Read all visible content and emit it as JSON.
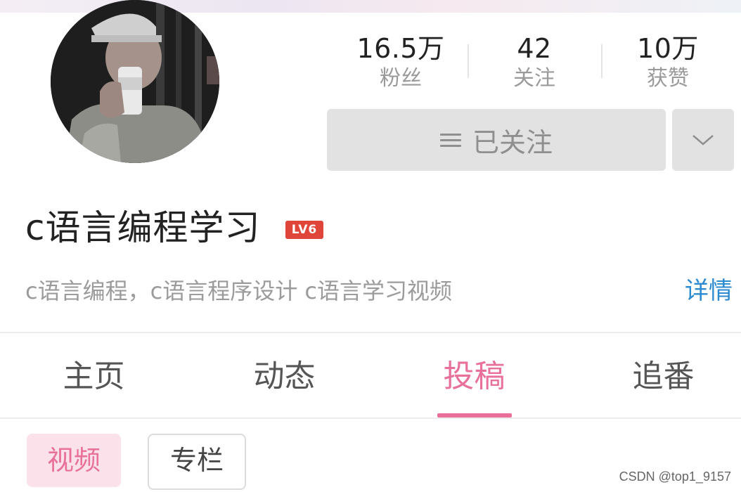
{
  "profile": {
    "name": "c语言编程学习",
    "level": "LV6",
    "description": "c语言编程，c语言程序设计 c语言学习视频",
    "detail_link": "详情"
  },
  "stats": [
    {
      "value": "16.5万",
      "label": "粉丝"
    },
    {
      "value": "42",
      "label": "关注"
    },
    {
      "value": "10万",
      "label": "获赞"
    }
  ],
  "follow_button": {
    "label": "已关注",
    "icon": "menu-icon"
  },
  "dropdown_button": {
    "icon": "chevron-down-icon"
  },
  "tabs": [
    {
      "label": "主页",
      "active": false
    },
    {
      "label": "动态",
      "active": false
    },
    {
      "label": "投稿",
      "active": true
    },
    {
      "label": "追番",
      "active": false
    }
  ],
  "filters": [
    {
      "label": "视频",
      "selected": true
    },
    {
      "label": "专栏",
      "selected": false
    }
  ],
  "watermark": "CSDN @top1_9157",
  "colors": {
    "accent_pink": "#e8709a",
    "link_blue": "#2b8ad0",
    "level_badge": "#e0453a",
    "button_gray": "#e2e2e2"
  }
}
